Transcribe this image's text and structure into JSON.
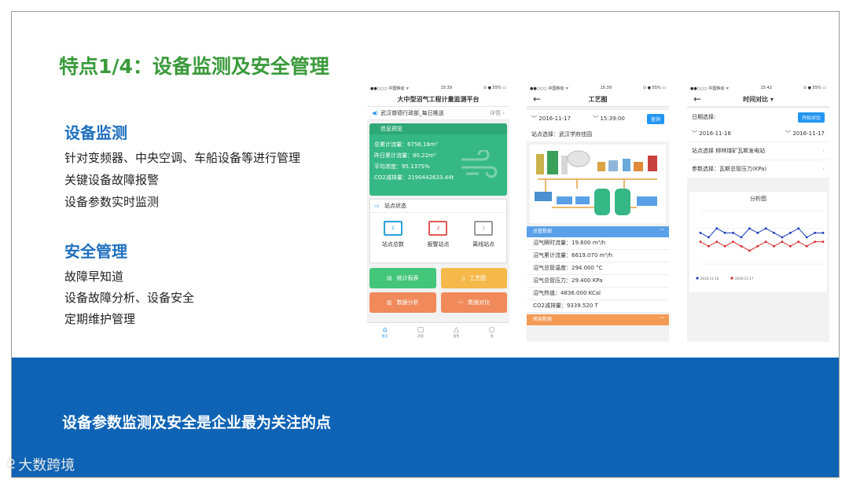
{
  "slide": {
    "title": "特点1/4：设备监测及安全管理",
    "section1": {
      "heading": "设备监测",
      "lines": [
        "针对变频器、中央空调、车船设备等进行管理",
        "关键设备故障报警",
        "设备参数实时监测"
      ]
    },
    "section2": {
      "heading": "安全管理",
      "lines": [
        "故障早知道",
        "设备故障分析、设备安全",
        "定期维护管理"
      ]
    },
    "footer": "设备参数监测及安全是企业最为关注的点",
    "watermark": "大数跨境"
  },
  "phone1": {
    "status": {
      "carrier": "●●○○○ 中国移动 ᯤ",
      "time": "15:39",
      "battery": "⊙ ● 55% ▭"
    },
    "nav_title": "大中型沼气工程计量监测平台",
    "notice": "武汉普德行政部_每日推送",
    "notice_link": "详情 ›",
    "info": {
      "header": "信息预览",
      "lines": [
        "总累计流量：6756.16m³",
        "昨日累计流量：80.22m³",
        "平均浓度：95.1375%",
        "CO2减排量：2190442633.44t"
      ]
    },
    "station": {
      "header": "站点状态",
      "items": [
        {
          "label": "站点总数",
          "count": "2",
          "color": "#2aa2d8"
        },
        {
          "label": "报警站点",
          "count": "2",
          "color": "#e05a55"
        },
        {
          "label": "离线站点",
          "count": "1",
          "color": "#9a9a9a"
        }
      ]
    },
    "tiles": [
      {
        "label": "统计报表",
        "color": "#43c57a"
      },
      {
        "label": "工艺图",
        "color": "#f5b84a"
      },
      {
        "label": "数据分析",
        "color": "#f08a5a"
      },
      {
        "label": "数据对比",
        "color": "#f08a5a"
      }
    ],
    "tabs": [
      "首页",
      "消息",
      "报警",
      "我"
    ]
  },
  "phone2": {
    "status": {
      "carrier": "●●○○○ 中国移动 ᯤ",
      "time": "15:39",
      "battery": "⊙ ● 55% ▭"
    },
    "nav_title": "工艺图",
    "date": "2016-11-17",
    "time": "15:39:00",
    "query_btn": "查询",
    "site_select": "站点选择：武汉学府佳园",
    "section_bar": "总管数据",
    "data_lines": [
      "沼气瞬时流量：19.600 m³/h",
      "沼气累计流量：6619.070 m³/h",
      "沼气总管温度：294.000 °C",
      "沼气总管压力：29.400 KPa",
      "沼气热值：4836.000 KCal",
      "CO2减排量：9339.520 T"
    ],
    "section_bar2": "高架数据"
  },
  "phone3": {
    "status": {
      "carrier": "●●○○○ 中国移动 ᯤ",
      "time": "15:42",
      "battery": "⊙ ● 55% ▭"
    },
    "nav_title": "时间对比 ▾",
    "date_label": "日期选择:",
    "start_btn": "开始对比",
    "date1": "2016-11-16",
    "date2": "2016-11-17",
    "site_row": "站点选择  柳林煤矿瓦斯发电站",
    "param_row": "参数选择：瓦斯总管压力(KPa)",
    "chart_title": "分析图",
    "legend": [
      "2016-11-16",
      "2016-11-17"
    ]
  },
  "chart_data": {
    "type": "line",
    "title": "分析图",
    "series": [
      {
        "name": "2016-11-16",
        "values": [
          12.3,
          12.2,
          12.4,
          12.3,
          12.3,
          12.2,
          12.4,
          12.3,
          12.4,
          12.3,
          12.2,
          12.3,
          12.4,
          12.2,
          12.3,
          12.3
        ],
        "color": "#1f3fbf"
      },
      {
        "name": "2016-11-17",
        "values": [
          12.1,
          12.0,
          12.1,
          12.0,
          12.1,
          12.0,
          11.9,
          12.0,
          12.1,
          12.0,
          12.1,
          12.0,
          12.1,
          12.0,
          12.1,
          12.1
        ],
        "color": "#d92b2b"
      }
    ],
    "ylim": [
      11.6,
      12.8
    ]
  },
  "colors": {
    "title_green": "#3a9a3a",
    "heading_blue": "#1f6fbf",
    "band_blue": "#0e63b5"
  },
  "icons": [
    "speaker-icon",
    "back-arrow-icon",
    "home-icon",
    "message-icon",
    "bell-icon",
    "user-icon",
    "monitor-icon"
  ]
}
